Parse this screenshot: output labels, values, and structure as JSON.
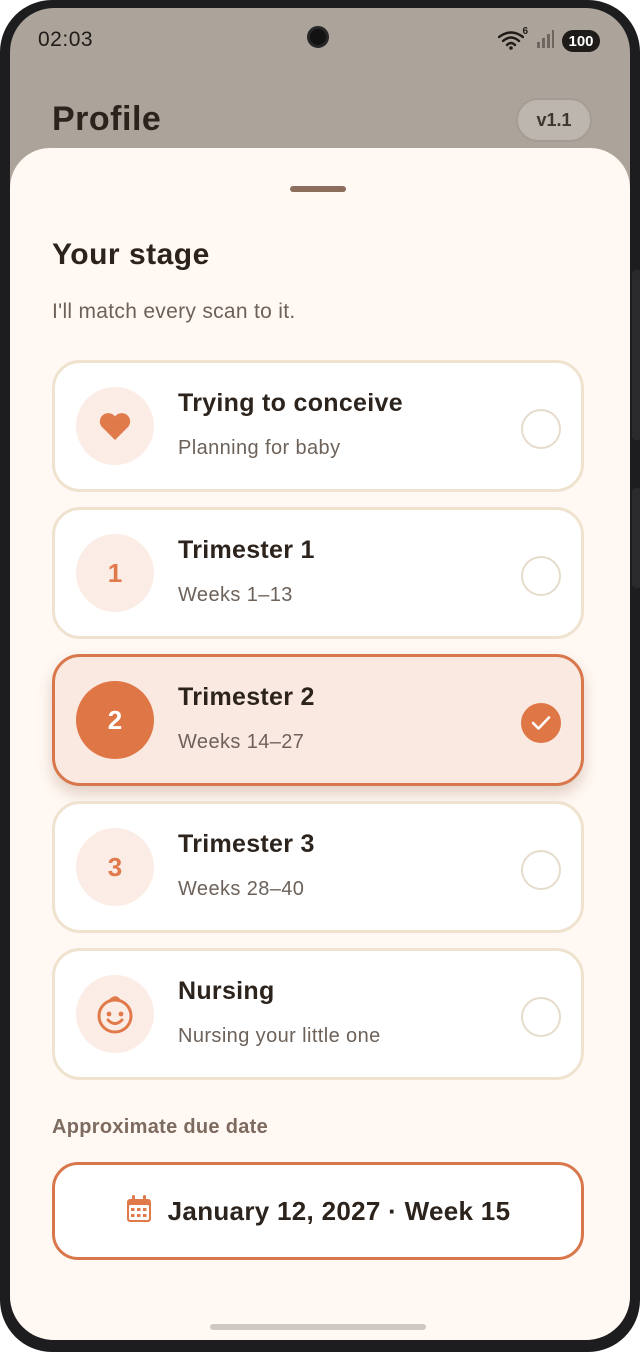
{
  "status_bar": {
    "time": "02:03",
    "wifi_badge": "6",
    "battery": "100"
  },
  "header": {
    "title": "Profile",
    "version": "v1.1"
  },
  "sheet": {
    "title": "Your stage",
    "subtitle": "I'll match every scan to it.",
    "options": [
      {
        "icon": "heart-icon",
        "badge": "",
        "title": "Trying to conceive",
        "subtitle": "Planning for baby",
        "selected": false
      },
      {
        "icon": "number-badge",
        "badge": "1",
        "title": "Trimester 1",
        "subtitle": "Weeks 1–13",
        "selected": false
      },
      {
        "icon": "number-badge",
        "badge": "2",
        "title": "Trimester 2",
        "subtitle": "Weeks 14–27",
        "selected": true
      },
      {
        "icon": "number-badge",
        "badge": "3",
        "title": "Trimester 3",
        "subtitle": "Weeks 28–40",
        "selected": false
      },
      {
        "icon": "baby-face-icon",
        "badge": "",
        "title": "Nursing",
        "subtitle": "Nursing your little one",
        "selected": false
      }
    ],
    "due_label": "Approximate due date",
    "due_value": "January 12, 2027 · Week 15"
  },
  "colors": {
    "accent": "#df7646",
    "sheet_background": "#fff8f3",
    "scrim": "#aca39a"
  }
}
